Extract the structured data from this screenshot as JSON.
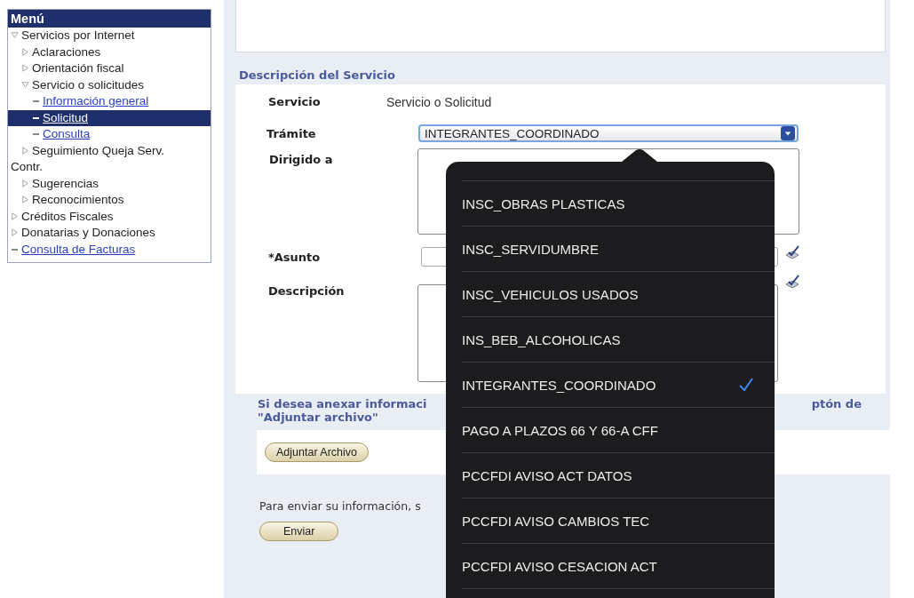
{
  "menu": {
    "title": "Menú",
    "items": [
      {
        "label": "Servicios por Internet",
        "kind": "folder",
        "expanded": true,
        "children": [
          {
            "label": "Aclaraciones",
            "kind": "folder",
            "expanded": false
          },
          {
            "label": "Orientación fiscal",
            "kind": "folder",
            "expanded": false
          },
          {
            "label": "Servicio o solicitudes",
            "kind": "folder",
            "expanded": true,
            "children": [
              {
                "label": "Información general",
                "kind": "link",
                "selected": false
              },
              {
                "label": "Solicitud",
                "kind": "link",
                "selected": true
              },
              {
                "label": "Consulta",
                "kind": "link",
                "selected": false
              }
            ]
          },
          {
            "label": "Seguimiento Queja Serv. Contr.",
            "kind": "folder",
            "expanded": false
          },
          {
            "label": "Sugerencias",
            "kind": "folder",
            "expanded": false
          },
          {
            "label": "Reconocimientos",
            "kind": "folder",
            "expanded": false
          }
        ]
      },
      {
        "label": "Créditos Fiscales",
        "kind": "folder",
        "expanded": false
      },
      {
        "label": "Donatarias y Donaciones",
        "kind": "folder",
        "expanded": false
      },
      {
        "label": "Consulta de Facturas",
        "kind": "link",
        "selected": false
      }
    ]
  },
  "section_title": "Descripción del Servicio",
  "form": {
    "servicio_label": "Servicio",
    "servicio_value": "Servicio o Solicitud",
    "tramite_label": "Trámite",
    "tramite_value": "INTEGRANTES_COORDINADO",
    "dirigido_label": "Dirigido a",
    "asunto_label": "*Asunto",
    "descripcion_label": "Descripción"
  },
  "attach_note": {
    "left": "Si desea anexar informaci",
    "right": "ptón de",
    "line2": "\"Adjuntar archivo\""
  },
  "attach_button": "Adjuntar Archivo",
  "send_note": "Para enviar su información, s",
  "send_button": "Enviar",
  "dropdown": {
    "options": [
      {
        "label": "INSC_OBRAS PLASTICAS",
        "selected": false
      },
      {
        "label": "INSC_SERVIDUMBRE",
        "selected": false
      },
      {
        "label": "INSC_VEHICULOS USADOS",
        "selected": false
      },
      {
        "label": "INS_BEB_ALCOHOLICAS",
        "selected": false
      },
      {
        "label": "INTEGRANTES_COORDINADO",
        "selected": true
      },
      {
        "label": "PAGO A PLAZOS 66 Y 66-A CFF",
        "selected": false
      },
      {
        "label": "PCCFDI AVISO ACT DATOS",
        "selected": false
      },
      {
        "label": "PCCFDI AVISO CAMBIOS TEC",
        "selected": false
      },
      {
        "label": "PCCFDI AVISO CESACION ACT",
        "selected": false
      }
    ]
  }
}
